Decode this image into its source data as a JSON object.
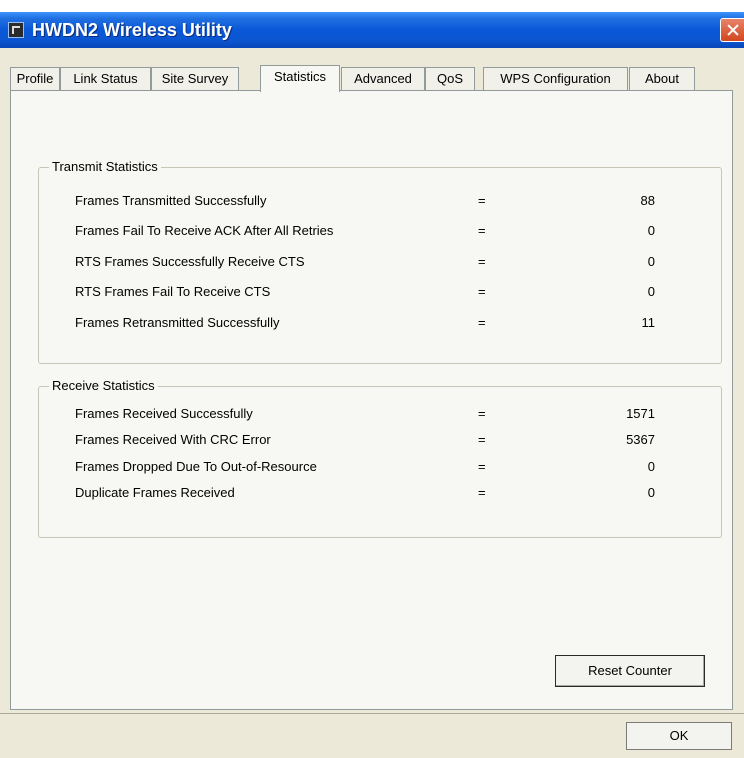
{
  "window": {
    "title": "HWDN2 Wireless Utility"
  },
  "tabs": [
    {
      "label": "Profile"
    },
    {
      "label": "Link Status"
    },
    {
      "label": "Site Survey"
    },
    {
      "label": "Statistics",
      "active": true
    },
    {
      "label": "Advanced"
    },
    {
      "label": "QoS"
    },
    {
      "label": "WPS Configuration"
    },
    {
      "label": "About"
    }
  ],
  "transmit": {
    "title": "Transmit Statistics",
    "rows": [
      {
        "label": "Frames Transmitted Successfully",
        "eq": "=",
        "value": "88"
      },
      {
        "label": "Frames Fail To Receive ACK After All Retries",
        "eq": "=",
        "value": "0"
      },
      {
        "label": "RTS Frames Successfully Receive CTS",
        "eq": "=",
        "value": "0"
      },
      {
        "label": "RTS Frames Fail To Receive CTS",
        "eq": "=",
        "value": "0"
      },
      {
        "label": "Frames Retransmitted Successfully",
        "eq": "=",
        "value": "11"
      }
    ]
  },
  "receive": {
    "title": "Receive Statistics",
    "rows": [
      {
        "label": "Frames Received Successfully",
        "eq": "=",
        "value": "1571"
      },
      {
        "label": "Frames Received With CRC Error",
        "eq": "=",
        "value": "5367"
      },
      {
        "label": "Frames Dropped Due To Out-of-Resource",
        "eq": "=",
        "value": "0"
      },
      {
        "label": "Duplicate Frames Received",
        "eq": "=",
        "value": "0"
      }
    ]
  },
  "buttons": {
    "reset": "Reset Counter",
    "ok": "OK"
  },
  "colors": {
    "titlebar": "#0a58d8",
    "close": "#d2461e",
    "panel": "#f7f7f3",
    "dialog": "#ece9d8"
  },
  "icons": {
    "app": "app-icon",
    "close": "close-icon"
  }
}
